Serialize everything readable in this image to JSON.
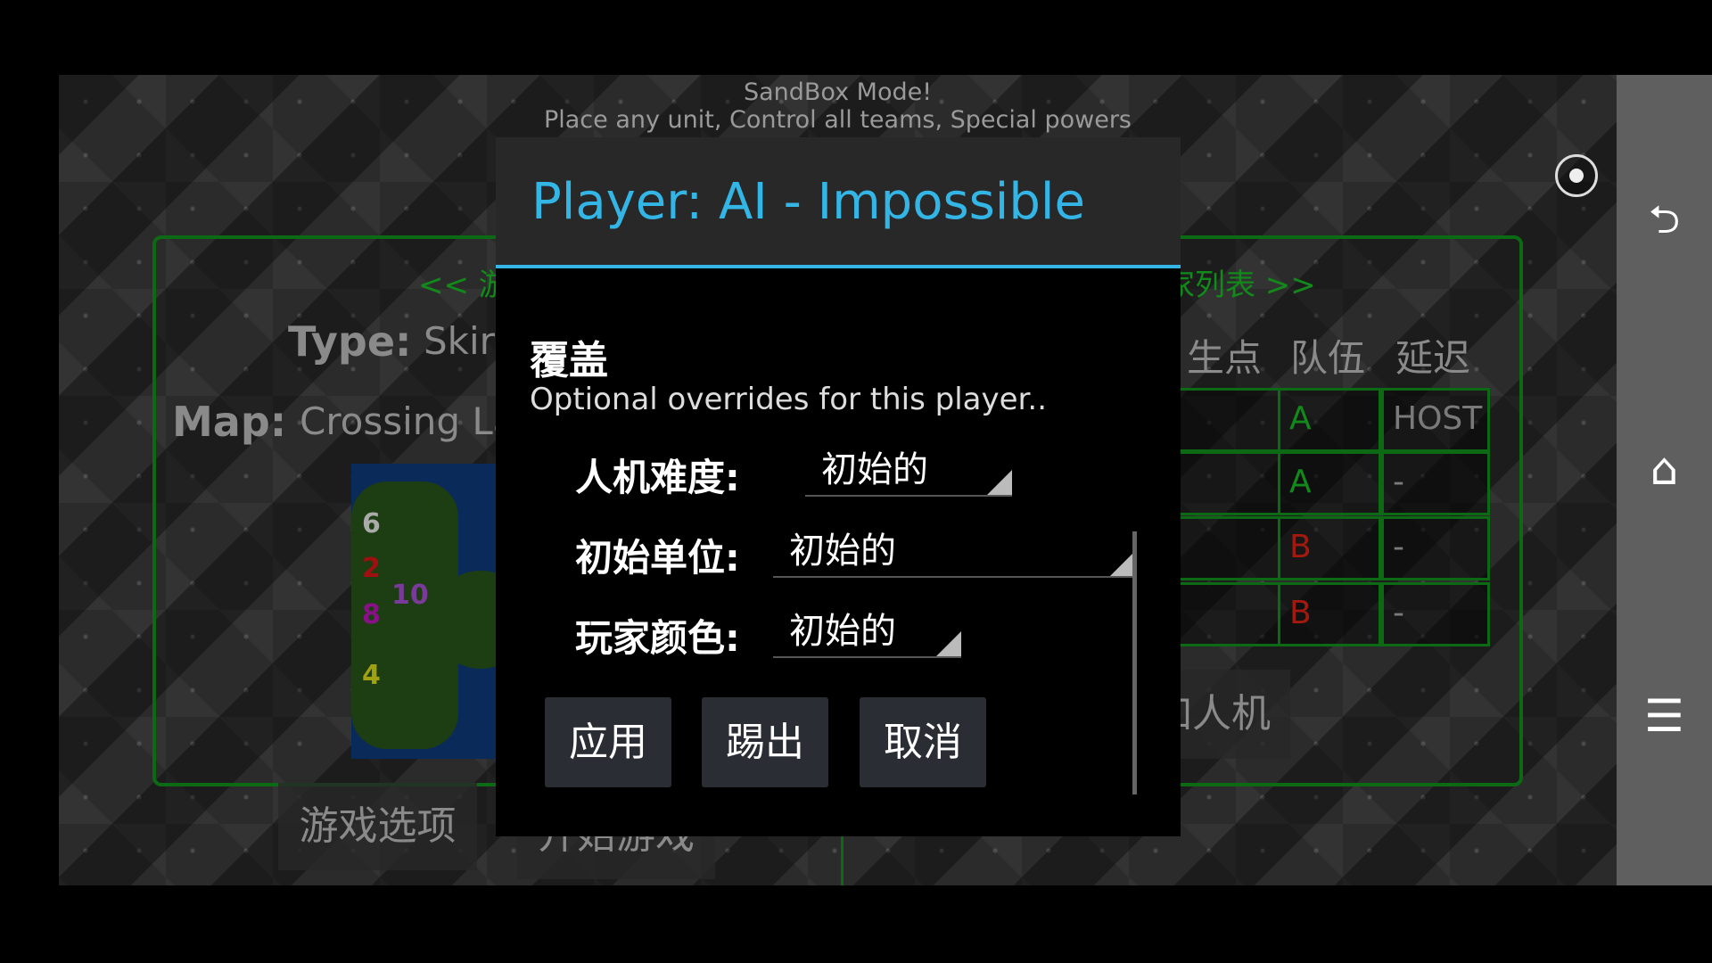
{
  "sandbox": {
    "line1": "SandBox Mode!",
    "line2": "Place any unit, Control all teams, Special powers"
  },
  "background": {
    "tab_left": "<< 游",
    "tab_right": "家列表 >>",
    "type_label": "Type:",
    "type_value": "Skirr",
    "map_label": "Map:",
    "map_value": "Crossing La",
    "map_markers": [
      "6",
      "2",
      "10",
      "8",
      "4"
    ],
    "game_options_button": "游戏选项",
    "start_button": "开始游戏",
    "add_ai_button": "加人机",
    "table": {
      "headers": [
        "生点",
        "队伍",
        "延迟"
      ],
      "rows": [
        {
          "team": "A",
          "ping": "HOST"
        },
        {
          "team": "A",
          "ping": "-"
        },
        {
          "team": "B",
          "ping": "-"
        },
        {
          "team": "B",
          "ping": "-"
        }
      ]
    },
    "team_colors": {
      "A": "#118a1a",
      "B": "#a01a10"
    }
  },
  "dialog": {
    "title": "Player: AI - Impossible",
    "section": "覆盖",
    "description": "Optional overrides for this player..",
    "fields": [
      {
        "label": "人机难度:",
        "value": "初始的"
      },
      {
        "label": "初始单位:",
        "value": "初始的"
      },
      {
        "label": "玩家颜色:",
        "value": "初始的"
      }
    ],
    "buttons": {
      "apply": "应用",
      "kick": "踢出",
      "cancel": "取消"
    },
    "accent": "#33b5e5"
  },
  "navbar": {
    "icons": [
      "record-icon",
      "back-icon",
      "home-icon",
      "menu-icon"
    ]
  }
}
